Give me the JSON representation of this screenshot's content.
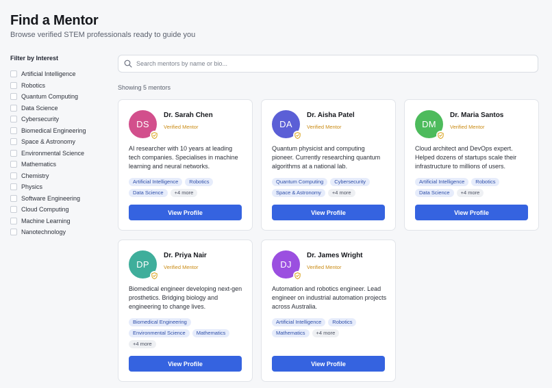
{
  "header": {
    "title": "Find a Mentor",
    "subtitle": "Browse verified STEM professionals ready to guide you"
  },
  "filters": {
    "heading": "Filter by Interest",
    "items": [
      {
        "label": "Artificial Intelligence",
        "checked": false
      },
      {
        "label": "Robotics",
        "checked": false
      },
      {
        "label": "Quantum Computing",
        "checked": false
      },
      {
        "label": "Data Science",
        "checked": false
      },
      {
        "label": "Cybersecurity",
        "checked": false
      },
      {
        "label": "Biomedical Engineering",
        "checked": false
      },
      {
        "label": "Space & Astronomy",
        "checked": false
      },
      {
        "label": "Environmental Science",
        "checked": false
      },
      {
        "label": "Mathematics",
        "checked": false
      },
      {
        "label": "Chemistry",
        "checked": false
      },
      {
        "label": "Physics",
        "checked": false
      },
      {
        "label": "Software Engineering",
        "checked": false
      },
      {
        "label": "Cloud Computing",
        "checked": false
      },
      {
        "label": "Machine Learning",
        "checked": false
      },
      {
        "label": "Nanotechnology",
        "checked": false
      }
    ]
  },
  "search": {
    "placeholder": "Search mentors by name or bio...",
    "value": "",
    "icon": "search-icon"
  },
  "results": {
    "showing_text": "Showing 5 mentors"
  },
  "mentors": [
    {
      "initials": "DS",
      "name": "Dr. Sarah Chen",
      "status": "Verified Mentor",
      "bio": "AI researcher with 10 years at leading tech companies. Specialises in machine learning and neural networks.",
      "tags": [
        "Artificial Intelligence",
        "Robotics",
        "Data Science"
      ],
      "more": "+4 more",
      "button": "View Profile",
      "avatar_color": "#d24f8c"
    },
    {
      "initials": "DA",
      "name": "Dr. Aisha Patel",
      "status": "Verified Mentor",
      "bio": "Quantum physicist and computing pioneer. Currently researching quantum algorithms at a national lab.",
      "tags": [
        "Quantum Computing",
        "Cybersecurity",
        "Space & Astronomy"
      ],
      "more": "+4 more",
      "button": "View Profile",
      "avatar_color": "#5b5fd6"
    },
    {
      "initials": "DM",
      "name": "Dr. Maria Santos",
      "status": "Verified Mentor",
      "bio": "Cloud architect and DevOps expert. Helped dozens of startups scale their infrastructure to millions of users.",
      "tags": [
        "Artificial Intelligence",
        "Robotics",
        "Data Science"
      ],
      "more": "+4 more",
      "button": "View Profile",
      "avatar_color": "#4dbb5c"
    },
    {
      "initials": "DP",
      "name": "Dr. Priya Nair",
      "status": "Verified Mentor",
      "bio": "Biomedical engineer developing next-gen prosthetics. Bridging biology and engineering to change lives.",
      "tags": [
        "Biomedical Engineering",
        "Environmental Science",
        "Mathematics"
      ],
      "more": "+4 more",
      "button": "View Profile",
      "avatar_color": "#3fae9b"
    },
    {
      "initials": "DJ",
      "name": "Dr. James Wright",
      "status": "Verified Mentor",
      "bio": "Automation and robotics engineer. Lead engineer on industrial automation projects across Australia.",
      "tags": [
        "Artificial Intelligence",
        "Robotics",
        "Mathematics"
      ],
      "more": "+4 more",
      "button": "View Profile",
      "avatar_color": "#9b4fe0"
    }
  ],
  "colors": {
    "accent": "#3563e0",
    "verified": "#c98a12",
    "badge_shield": "#d9a21b",
    "tag_bg": "#e6ecfb",
    "tag_text": "#2f4fa8"
  }
}
